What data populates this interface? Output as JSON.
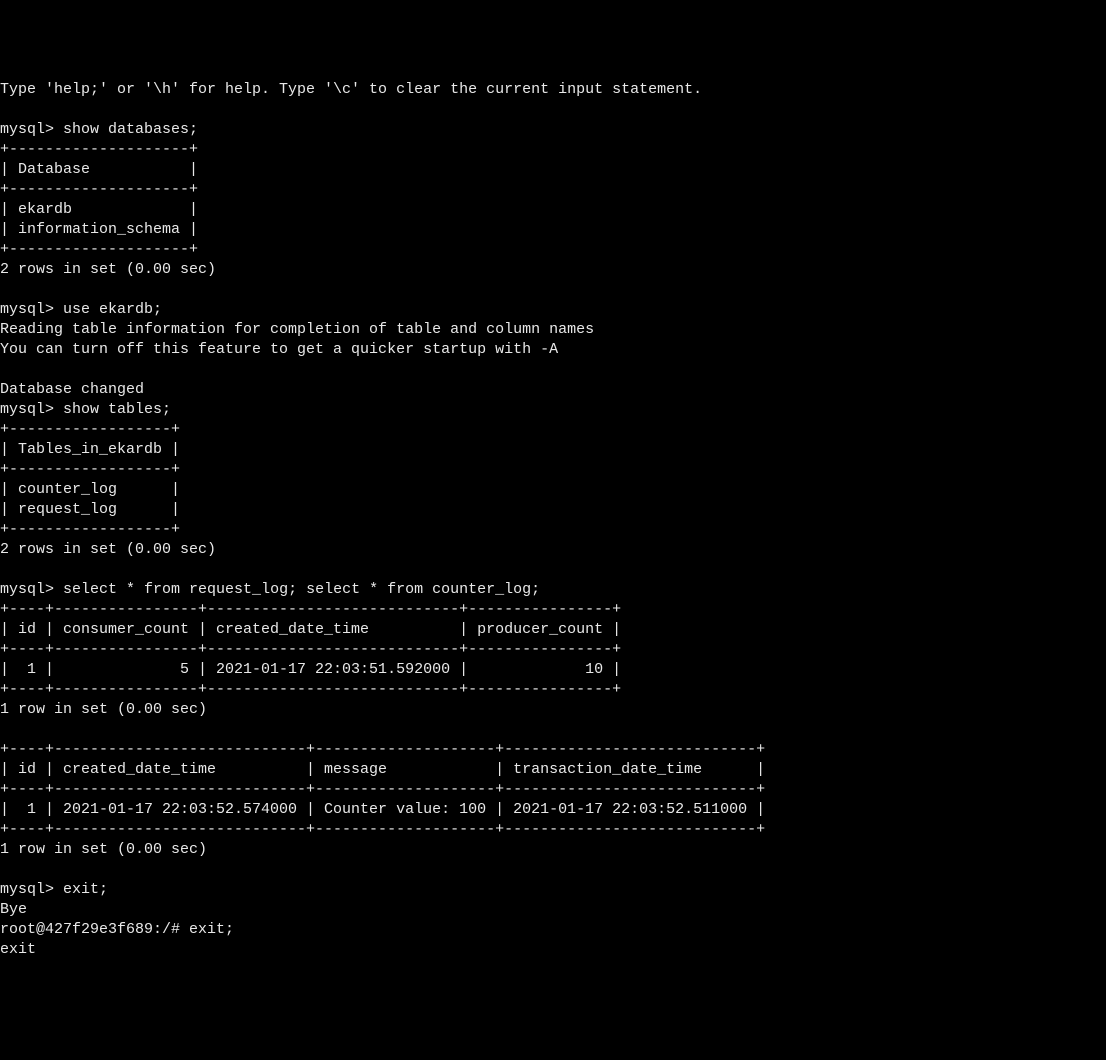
{
  "help_line": "Type 'help;' or '\\h' for help. Type '\\c' to clear the current input statement.",
  "prompt_mysql": "mysql>",
  "prompt_shell": "root@427f29e3f689:/#",
  "cmd_show_databases": "show databases;",
  "cmd_use_ekardb": "use ekardb;",
  "cmd_show_tables": "show tables;",
  "cmd_select_logs": "select * from request_log; select * from counter_log;",
  "cmd_exit_mysql": "exit;",
  "cmd_exit_shell": "exit;",
  "msg_bye": "Bye",
  "msg_exit": "exit",
  "databases_border": "+--------------------+",
  "databases_header": "| Database           |",
  "databases_rows": [
    "| ekardb             |",
    "| information_schema |"
  ],
  "result_2rows": "2 rows in set (0.00 sec)",
  "result_1row": "1 row in set (0.00 sec)",
  "msg_reading": "Reading table information for completion of table and column names",
  "msg_turnoff": "You can turn off this feature to get a quicker startup with -A",
  "msg_dbchanged": "Database changed",
  "tables_border": "+------------------+",
  "tables_header": "| Tables_in_ekardb |",
  "tables_rows": [
    "| counter_log      |",
    "| request_log      |"
  ],
  "request_border": "+----+----------------+----------------------------+----------------+",
  "request_header": "| id | consumer_count | created_date_time          | producer_count |",
  "request_row": "|  1 |              5 | 2021-01-17 22:03:51.592000 |             10 |",
  "counter_border": "+----+----------------------------+--------------------+----------------------------+",
  "counter_header": "| id | created_date_time          | message            | transaction_date_time      |",
  "counter_row": "|  1 | 2021-01-17 22:03:52.574000 | Counter value: 100 | 2021-01-17 22:03:52.511000 |"
}
